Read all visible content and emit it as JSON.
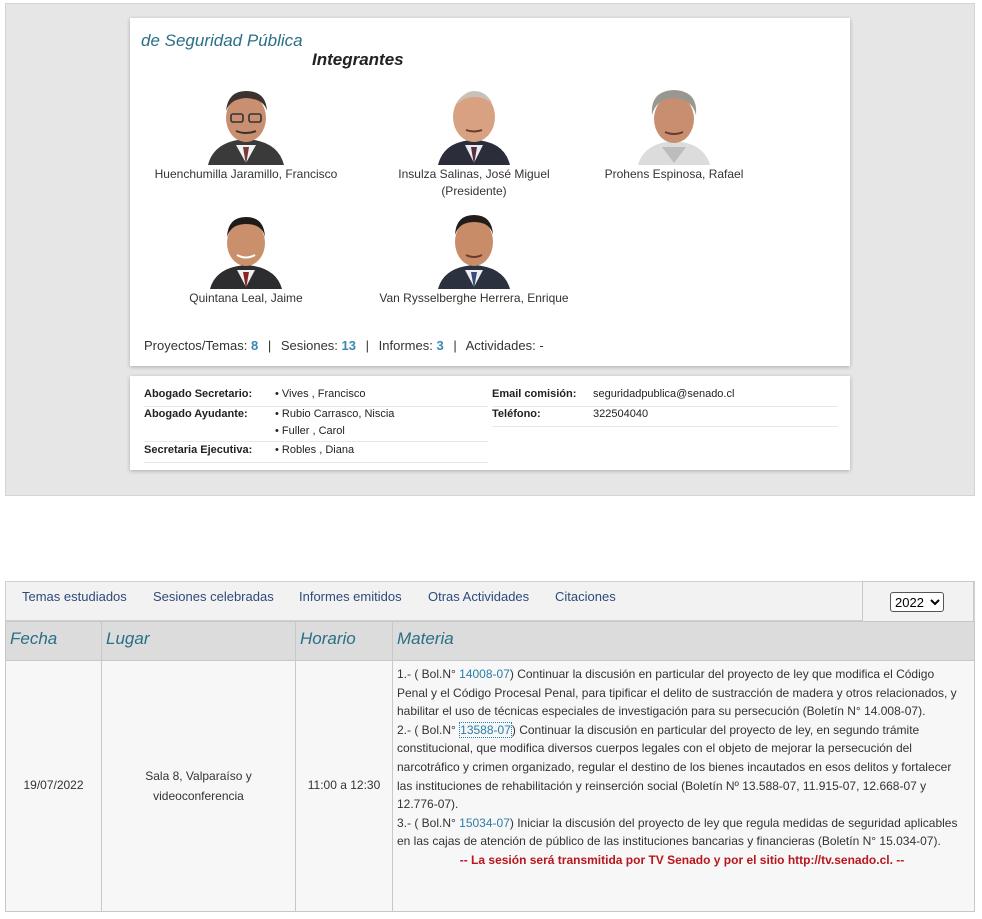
{
  "committee": {
    "title": "de Seguridad Pública",
    "members_heading": "Integrantes",
    "members": [
      {
        "name": "Huenchumilla Jaramillo, Francisco",
        "role": ""
      },
      {
        "name": "Insulza Salinas, José Miguel",
        "role": "(Presidente)"
      },
      {
        "name": "Prohens Espinosa, Rafael",
        "role": ""
      },
      {
        "name": "Quintana Leal, Jaime",
        "role": ""
      },
      {
        "name": "Van Rysselberghe Herrera, Enrique",
        "role": ""
      }
    ],
    "stats": {
      "proyectos_label": "Proyectos/Temas:",
      "proyectos": "8",
      "sesiones_label": "Sesiones:",
      "sesiones": "13",
      "informes_label": "Informes:",
      "informes": "3",
      "actividades_label": "Actividades:",
      "actividades": "-"
    }
  },
  "staff": {
    "secretario_label": "Abogado Secretario:",
    "secretario": "• Vives , Francisco",
    "ayudante_label": "Abogado Ayudante:",
    "ayudante_1": "• Rubio Carrasco, Niscia",
    "ayudante_2": "• Fuller , Carol",
    "ejecutiva_label": "Secretaria Ejecutiva:",
    "ejecutiva": "• Robles , Diana",
    "email_label": "Email comisión:",
    "email": "seguridadpublica@senado.cl",
    "telefono_label": "Teléfono:",
    "telefono": "322504040"
  },
  "tabs": [
    "Temas estudiados",
    "Sesiones celebradas",
    "Informes emitidos",
    "Otras Actividades",
    "Citaciones"
  ],
  "year_select": {
    "selected": "2022"
  },
  "table": {
    "headers": {
      "fecha": "Fecha",
      "lugar": "Lugar",
      "horario": "Horario",
      "materia": "Materia"
    },
    "row": {
      "fecha": "19/07/2022",
      "lugar_1": "Sala 8, Valparaíso y",
      "lugar_2": "videoconferencia",
      "horario": "11:00 a 12:30",
      "items": [
        {
          "prefix": "1.- ( Bol.N° ",
          "bol": "14008-07",
          "text": ") Continuar la discusión en particular del proyecto de ley que modifica el Código Penal y el Código Procesal Penal, para tipificar el delito de sustracción de madera y otros relacionados, y habilitar el uso de técnicas especiales de investigación para su persecución (Boletín N° 14.008-07)."
        },
        {
          "prefix": "2.- ( Bol.N° ",
          "bol": "13588-07",
          "text": ") Continuar la discusión en particular del proyecto de ley, en segundo trámite constitucional, que modifica diversos cuerpos legales con el objeto de mejorar la persecución del narcotráfico y crimen organizado, regular el destino de los bienes incautados en esos delitos y fortalecer las instituciones de rehabilitación y reinserción social (Boletín Nº 13.588-07, 11.915-07, 12.668-07 y 12.776-07)."
        },
        {
          "prefix": "3.- ( Bol.N° ",
          "bol": "15034-07",
          "text": ") Iniciar la discusión del proyecto de ley que regula medidas de seguridad aplicables en las cajas de atención de público de las instituciones bancarias y financieras (Boletín N° 15.034-07)."
        }
      ],
      "notice": "-- La sesión será transmitida por TV Senado y por el sitio http://tv.senado.cl. --"
    }
  }
}
